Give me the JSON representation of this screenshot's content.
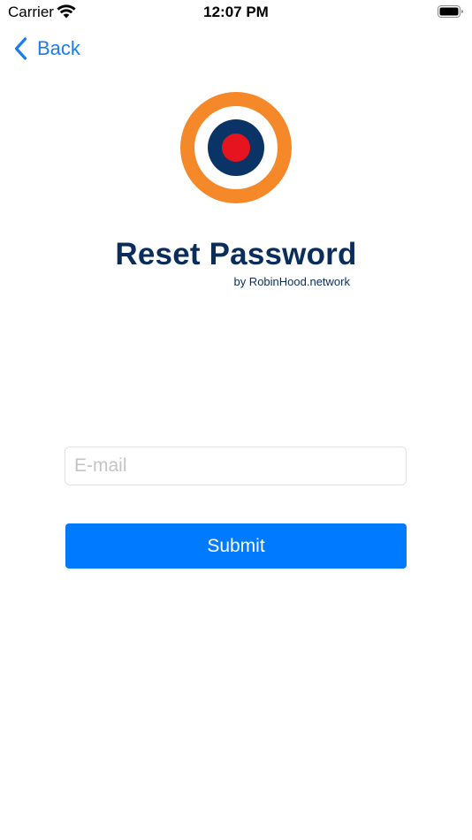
{
  "status_bar": {
    "carrier": "Carrier",
    "time": "12:07 PM",
    "icons": [
      "wifi-icon",
      "battery-icon"
    ]
  },
  "nav": {
    "back_label": "Back",
    "back_icon": "chevron-left-icon"
  },
  "header": {
    "logo_icon": "roundel-target-icon",
    "title": "Reset Password",
    "byline": "by RobinHood.network"
  },
  "form": {
    "email_placeholder": "E-mail",
    "email_value": "",
    "submit_label": "Submit"
  },
  "colors": {
    "accent": "#007bff",
    "link": "#1a7cf0",
    "title": "#0b2d5b",
    "logo_outer": "#f5892a",
    "logo_middle": "#0b3466",
    "logo_center": "#e5141f"
  }
}
